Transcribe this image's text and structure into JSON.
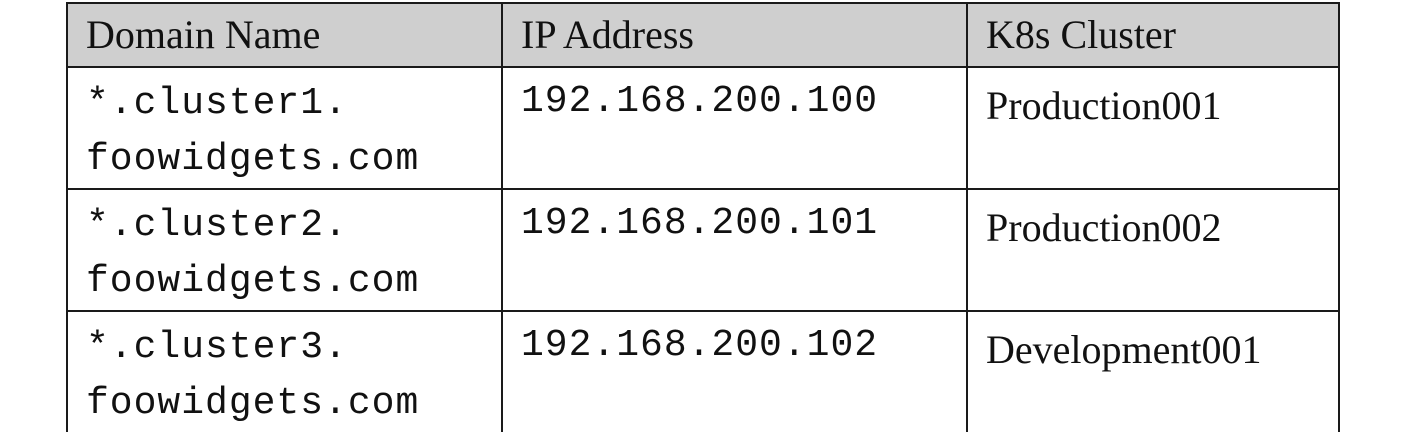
{
  "table": {
    "headers": [
      "Domain Name",
      "IP Address",
      "K8s Cluster"
    ],
    "rows": [
      {
        "domain_line1": "*.cluster1.",
        "domain_line2": "foowidgets.com",
        "ip": "192.168.200.100",
        "cluster": "Production001"
      },
      {
        "domain_line1": "*.cluster2.",
        "domain_line2": "foowidgets.com",
        "ip": "192.168.200.101",
        "cluster": "Production002"
      },
      {
        "domain_line1": "*.cluster3.",
        "domain_line2": "foowidgets.com",
        "ip": "192.168.200.102",
        "cluster": "Development001"
      }
    ],
    "colors": {
      "header_background": "#cfcfcf",
      "border": "#1a1a1a"
    }
  }
}
